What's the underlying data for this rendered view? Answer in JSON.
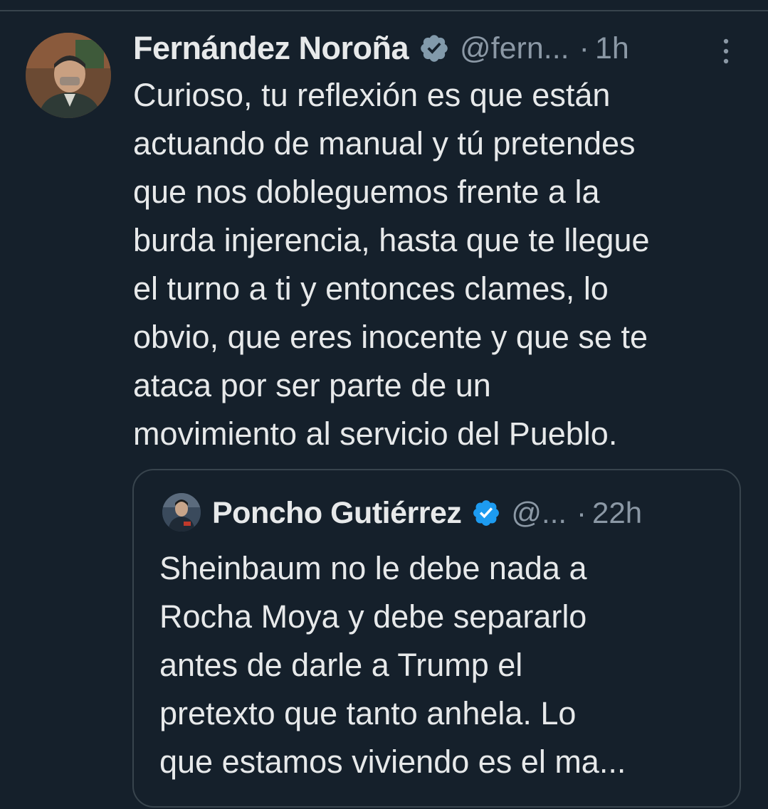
{
  "tweet": {
    "author_name": "Fernández Noroña",
    "handle": "@fern...",
    "separator": "·",
    "time": "1h",
    "avatar_icon": "user-avatar-photo",
    "verified_icon": "verified-badge-icon",
    "more_icon": "more-vertical-icon",
    "text_lines": [
      "Curioso, tu reflexión es que están",
      "actuando de manual y tú pretendes",
      "que nos dobleguemos frente a la",
      "burda injerencia, hasta que te llegue",
      "el turno a ti y entonces clames, lo",
      "obvio, que eres inocente y que se te",
      "ataca por ser parte de un",
      "movimiento al servicio del Pueblo."
    ]
  },
  "quoted_tweet": {
    "author_name": "Poncho Gutiérrez",
    "handle": "@...",
    "separator": "·",
    "time": "22h",
    "avatar_icon": "user-avatar-photo",
    "verified_icon": "verified-badge-icon",
    "text_lines": [
      "Sheinbaum no le debe nada a",
      "Rocha Moya y debe separarlo",
      "antes de darle a Trump el",
      "pretexto que tanto anhela. Lo",
      "que estamos viviendo es el ma..."
    ]
  },
  "colors": {
    "background": "#15202b",
    "text_primary": "#e7e9ea",
    "text_secondary": "#8b98a5",
    "border": "#38444d",
    "verified_gray": "#829aab",
    "verified_blue": "#1d9bf0"
  }
}
